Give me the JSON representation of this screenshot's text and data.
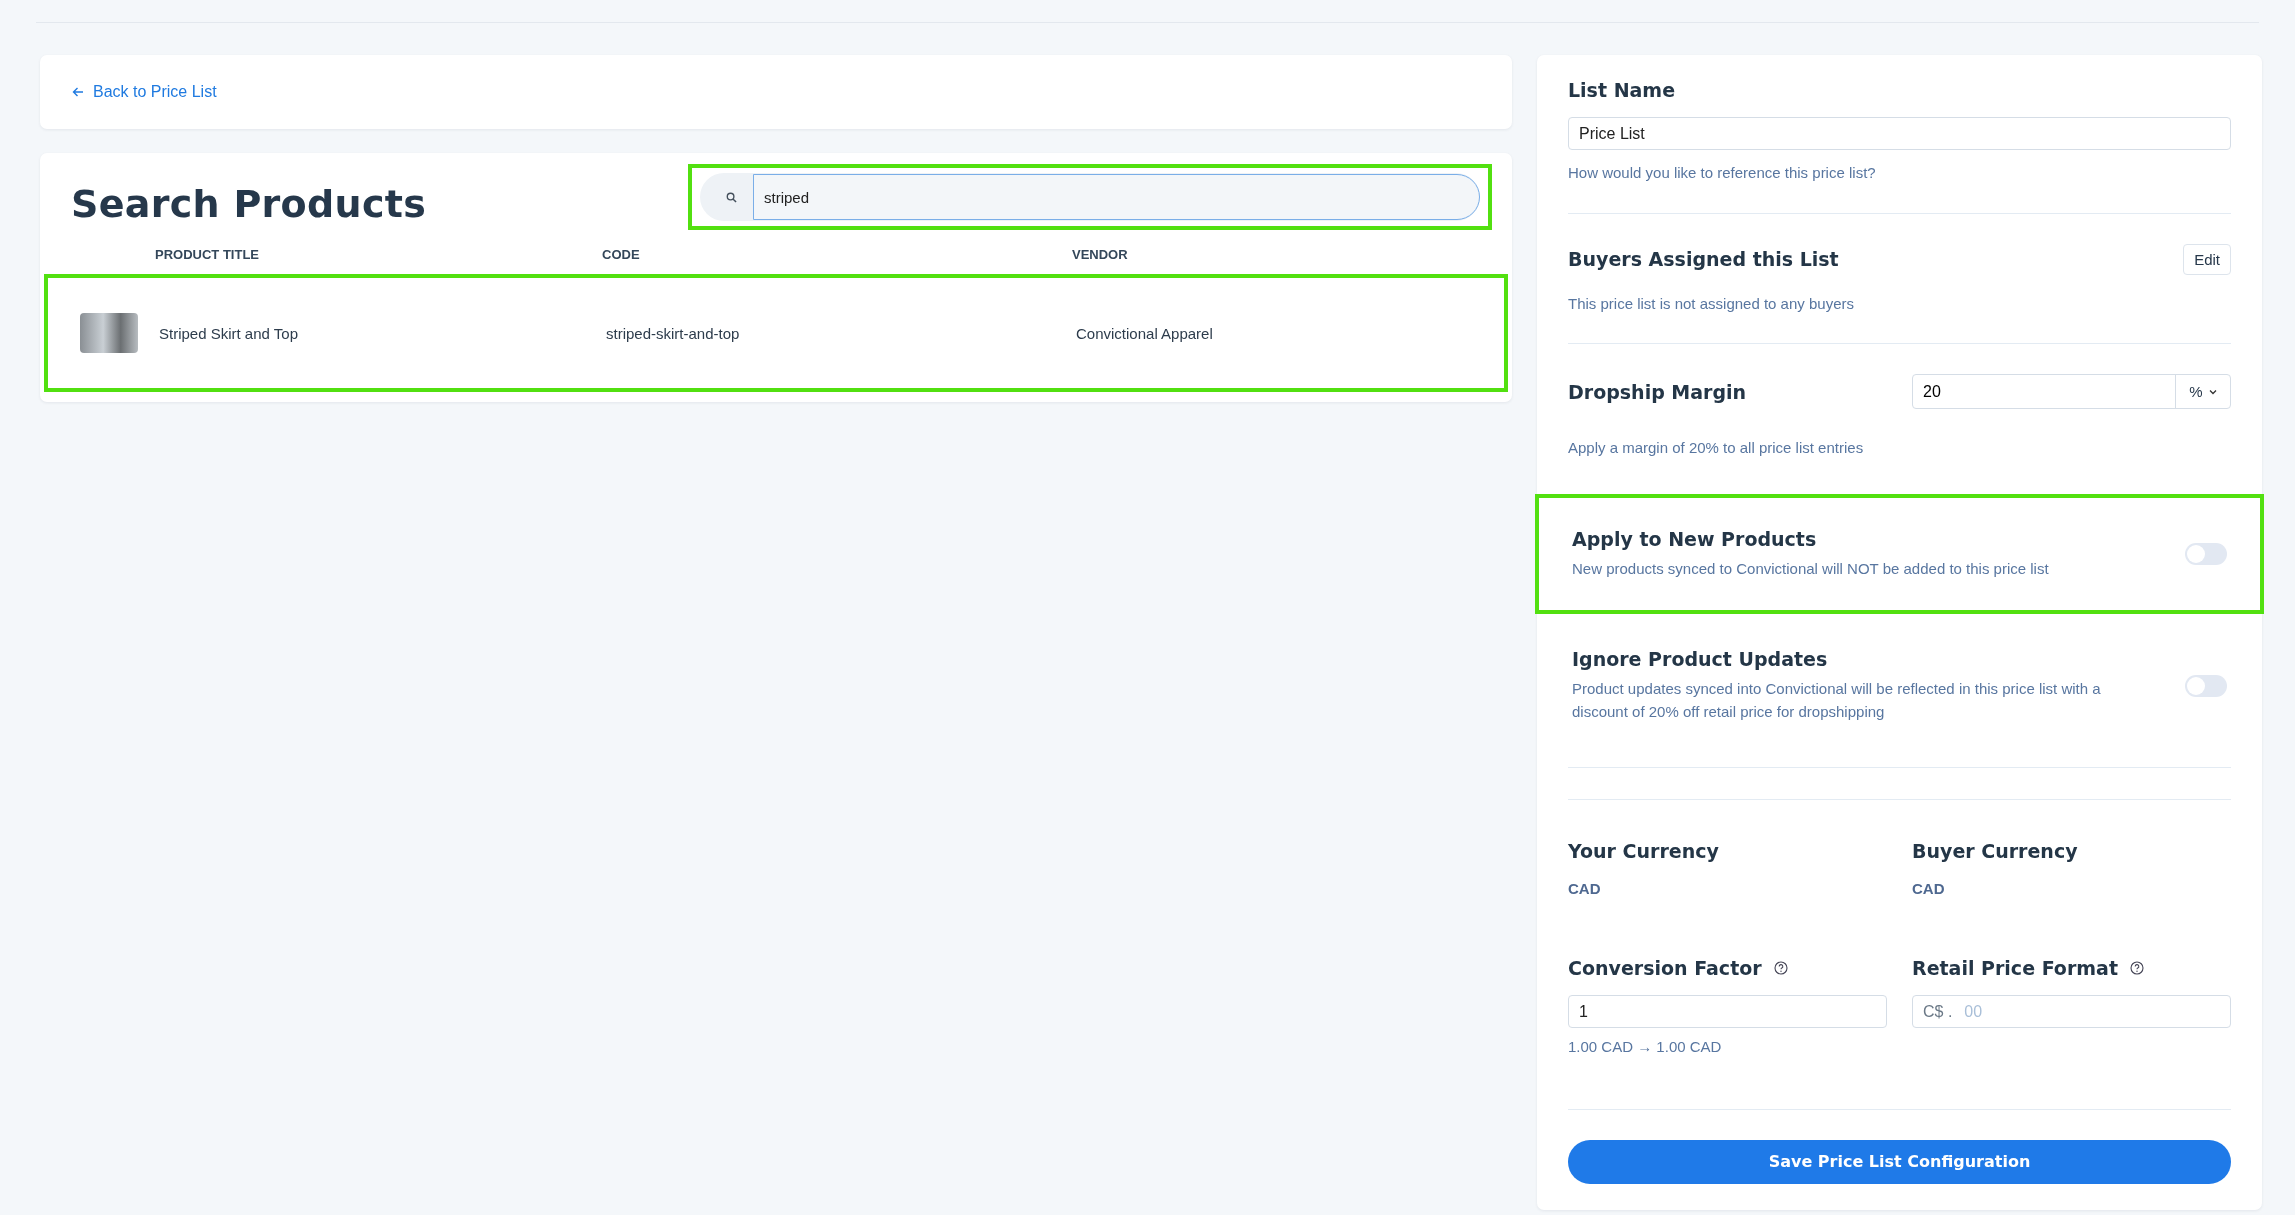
{
  "back_link": {
    "label": "Back to Price List"
  },
  "search_panel": {
    "title": "Search Products",
    "search": {
      "value": "striped",
      "highlighted": true
    },
    "table": {
      "columns": [
        "PRODUCT TITLE",
        "CODE",
        "VENDOR"
      ],
      "rows": [
        {
          "title": "Striped Skirt and Top",
          "code": "striped-skirt-and-top",
          "vendor": "Convictional Apparel",
          "highlighted": true
        }
      ]
    }
  },
  "settings": {
    "list_name": {
      "label": "List Name",
      "value": "Price List",
      "hint": "How would you like to reference this price list?"
    },
    "buyers": {
      "label": "Buyers Assigned this List",
      "button": "Edit",
      "note": "This price list is not assigned to any buyers"
    },
    "dropship_margin": {
      "label": "Dropship Margin",
      "value": "20",
      "unit": "%",
      "note": "Apply a margin of 20% to all price list entries"
    },
    "toggles": [
      {
        "label": "Apply to New Products",
        "description": "New products synced to Convictional will NOT be added to this price list",
        "on": false,
        "highlighted": true
      },
      {
        "label": "Ignore Product Updates",
        "description": "Product updates synced into Convictional will be reflected in this price list with a discount of 20% off retail price for dropshipping",
        "on": false,
        "highlighted": false
      }
    ],
    "currencies": [
      {
        "label": "Your Currency",
        "value": "CAD"
      },
      {
        "label": "Buyer Currency",
        "value": "CAD"
      }
    ],
    "conversion_factor": {
      "label": "Conversion Factor",
      "value": "1",
      "note": "1.00 CAD → 1.00 CAD"
    },
    "retail_price_format": {
      "label": "Retail Price Format",
      "prefix": "C$ .",
      "placeholder": "00"
    },
    "save_button": {
      "label": "Save Price List Configuration"
    }
  }
}
